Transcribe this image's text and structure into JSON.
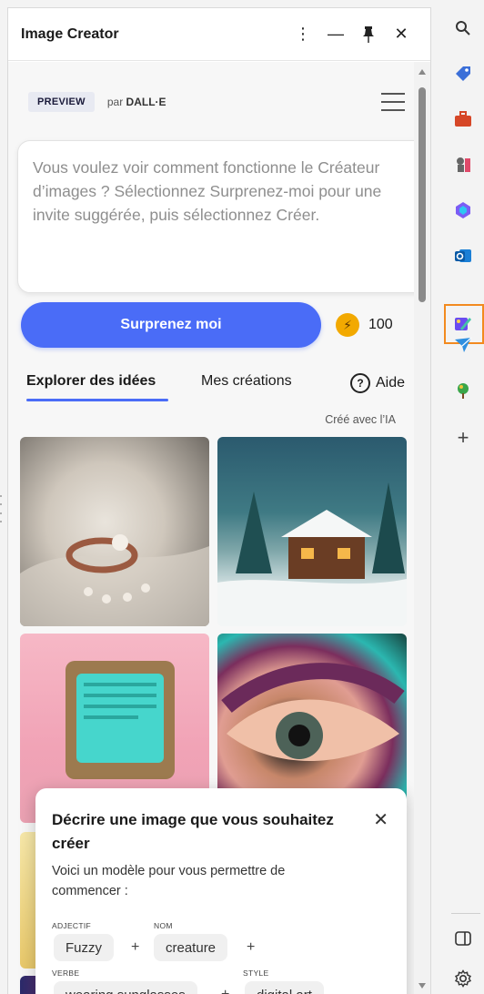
{
  "window": {
    "title": "Image Creator"
  },
  "preview": {
    "badge": "PREVIEW",
    "by_prefix": "par",
    "by_brand": "DALL·E"
  },
  "prompt": {
    "text": "Vous voulez voir comment fonctionne le Créateur d’images ? Sélectionnez Surprenez-moi pour une invite suggérée, puis sélectionnez Créer."
  },
  "surprise": {
    "label": "Surprenez moi",
    "boosts": "100"
  },
  "tabs": {
    "explore": "Explorer des idées",
    "mine": "Mes créations",
    "help": "Aide",
    "help_glyph": "?"
  },
  "ai_note": "Créé avec l’IA",
  "popup": {
    "title": "Décrire une image que vous souhaitez créer",
    "desc": "Voici un modèle pour vous permettre de commencer :",
    "labels": {
      "adj": "ADJECTIF",
      "noun": "NOM",
      "verb": "VERBE",
      "style": "STYLE"
    },
    "chips": {
      "adj": "Fuzzy",
      "noun": "creature",
      "verb": "wearing sunglasses",
      "style": "digital art"
    },
    "plus": "+"
  },
  "rightbar": {
    "icons": [
      "search-icon",
      "tag-icon",
      "briefcase-icon",
      "chess-icon",
      "copilot-icon",
      "outlook-icon",
      "image-creator-icon",
      "send-icon",
      "tree-icon",
      "add-icon",
      "sidebar-toggle-icon",
      "settings-icon"
    ],
    "selected": "image-creator-icon",
    "accent": "#f28a1f"
  },
  "colors": {
    "primary": "#4a6cf7",
    "boost": "#f2a900"
  }
}
